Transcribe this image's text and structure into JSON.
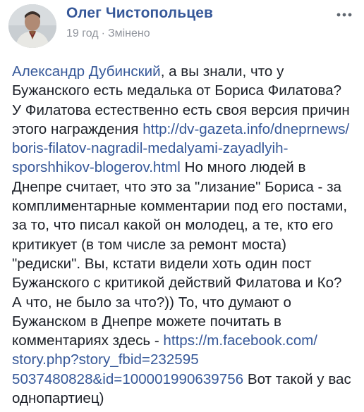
{
  "post": {
    "author": "Олег Чистопольцев",
    "time": "19 год",
    "separator": "·",
    "edited": "Змінено",
    "more_icon": "more-horizontal-dots-icon",
    "body": {
      "mention": "Александр Дубинский",
      "t1": ", а вы знали, что у",
      "t2": "Бужанского есть медалька от Бориса Филатова?",
      "t3": "У Филатова естественно есть своя версия причин",
      "t4": "этого награждения ",
      "link1_a": "http://dv-gazeta.info/dneprnews/",
      "link1_b": "boris-filatov-nagradil-medalyami-zayadlyih-",
      "link1_c": "sporshhikov-blogerov.html",
      "t5": " Но много людей в",
      "t6": "Днепре считает, что это за \"лизание\" Бориса - за",
      "t7": "комплиментарные комментарии под его постами,",
      "t8": "за то, что писал какой он молодец, а те, кто его",
      "t9": "критикует (в том числе за ремонт моста)",
      "t10": "\"редиски\". Вы, кстати видели хоть один пост",
      "t11": "Бужанского с критикой действий Филатова и Ко?",
      "t12": "А что, не было за что?)) То, что думают о",
      "t13": "Бужанском в Днепре можете почитать в",
      "t14": "комментариях здесь - ",
      "link2_a": "https://m.facebook.com/",
      "link2_b": "story.php?story_fbid=232595",
      "link2_c": "5037480828&id=100001990639756",
      "t15": " Вот такой у вас",
      "t16": "однопартиец)"
    }
  },
  "colors": {
    "link": "#365899",
    "text": "#1d2129",
    "meta": "#90949c"
  }
}
